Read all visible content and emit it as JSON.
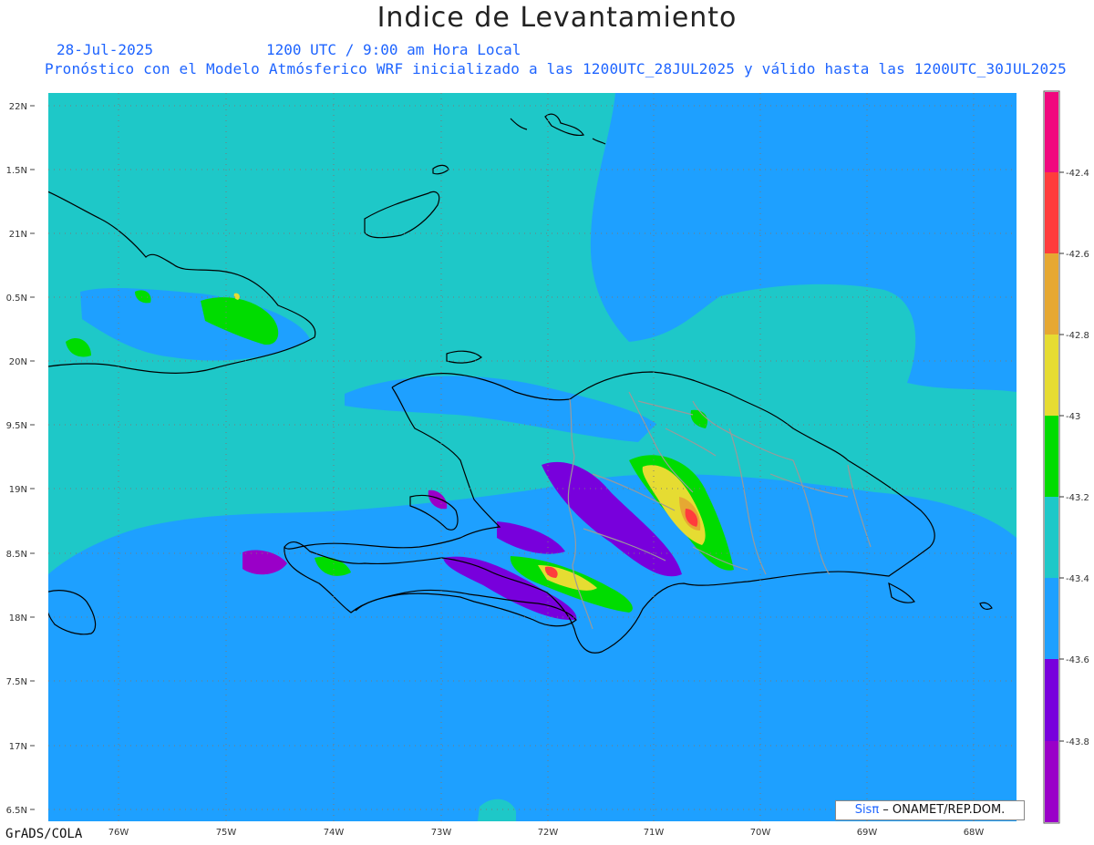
{
  "header": {
    "title": "Indice de Levantamiento",
    "date": "28-Jul-2025",
    "time": "1200 UTC / 9:00 am Hora Local",
    "description": "Pronóstico con el Modelo Atmósferico WRF inicializado a las 1200UTC_28JUL2025 y válido hasta las  1200UTC_30JUL2025"
  },
  "map": {
    "lat_labels": [
      "22N",
      "1.5N",
      "21N",
      "0.5N",
      "20N",
      "9.5N",
      "19N",
      "8.5N",
      "18N",
      "7.5N",
      "17N",
      "6.5N"
    ],
    "lon_labels": [
      "76W",
      "75W",
      "74W",
      "73W",
      "72W",
      "71W",
      "70W",
      "69W",
      "68W"
    ],
    "colors": {
      "ocean_low": "#1ea0ff",
      "ocean_mid": "#1ec8c8"
    }
  },
  "colorbar": {
    "labels": [
      "-42.4",
      "-42.6",
      "-42.8",
      "-43",
      "-43.2",
      "-43.4",
      "-43.6",
      "-43.8"
    ],
    "colors": [
      "#9a00c8",
      "#7800dc",
      "#1ea0ff",
      "#1ec8c8",
      "#00dc00",
      "#e6dc32",
      "#e6a832",
      "#ff3c3c",
      "#f0087e"
    ]
  },
  "footer": {
    "software": "GrADS/COLA",
    "credit_brand": "Sisπ",
    "credit_text": " – ONAMET/REP.DOM."
  }
}
